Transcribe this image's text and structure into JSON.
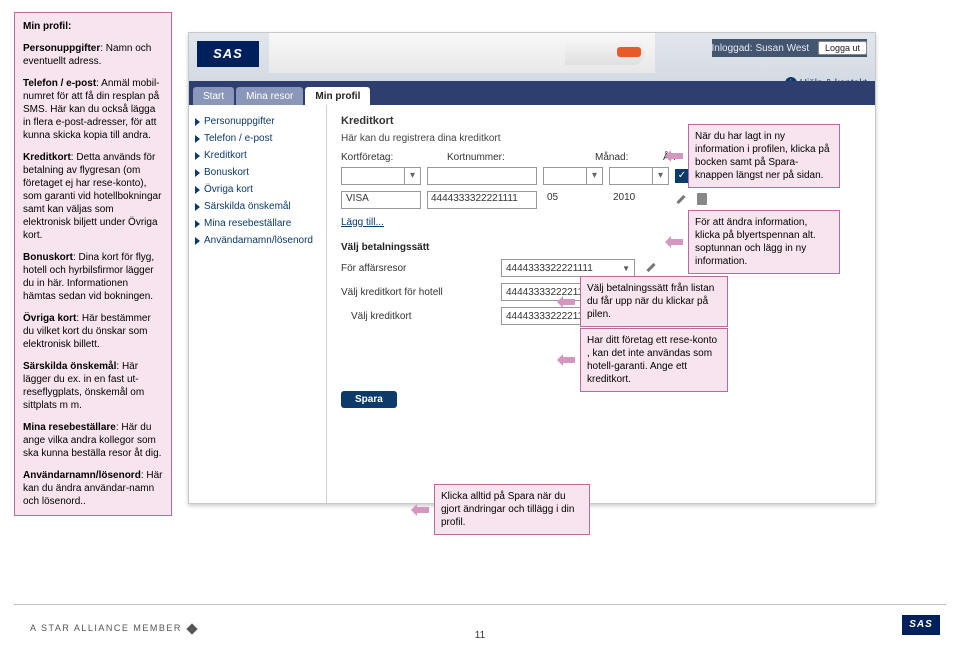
{
  "left": {
    "title": "Min profil:",
    "p1_b": "Personuppgifter",
    "p1_t": ": Namn och eventuellt adress.",
    "p2_b": "Telefon / e-post",
    "p2_t": ": Anmäl mobil-numret för att få din resplan på SMS. Här kan du också lägga in flera e-post-adresser, för att kunna skicka kopia till andra.",
    "p3_b": "Kreditkort",
    "p3_t": ": Detta används för betalning av flygresan (om företaget ej har rese-konto), som garanti vid hotellbokningar samt kan väljas som elektronisk biljett under Övriga kort.",
    "p4_b": "Bonuskort",
    "p4_t": ": Dina kort för flyg, hotell och hyrbilsfirmor lägger du in här. Informationen hämtas sedan vid bokningen.",
    "p5_b": "Övriga kort",
    "p5_t": ": Här bestämmer du vilket kort du önskar som elektronisk billett.",
    "p6_b": "Särskilda önskemål",
    "p6_t": ": Här lägger du ex. in en fast ut-reseflygplats, önskemål om sittplats m m.",
    "p7_b": "Mina resebeställare",
    "p7_t": ": Här du ange vilka andra kollegor som ska kunna beställa resor åt dig.",
    "p8_b": "Användarnamn/lösenord",
    "p8_t": ": Här kan du ändra användar-namn och lösenord.."
  },
  "header": {
    "logo": "SAS",
    "logged_prefix": "Inloggad: ",
    "user": "Susan West",
    "logout": "Logga ut",
    "help": "Hjälp & kontakt"
  },
  "tabs": {
    "t1": "Start",
    "t2": "Mina resor",
    "t3": "Min profil"
  },
  "nav": {
    "n1": "Personuppgifter",
    "n2": "Telefon / e-post",
    "n3": "Kreditkort",
    "n4": "Bonuskort",
    "n5": "Övriga kort",
    "n6": "Särskilda önskemål",
    "n7": "Mina resebeställare",
    "n8": "Användarnamn/lösenord"
  },
  "form": {
    "heading": "Kreditkort",
    "sub": "Här kan du registrera dina kreditkort",
    "lbl_company": "Kortföretag:",
    "lbl_number": "Kortnummer:",
    "lbl_month": "Månad:",
    "lbl_year": "År:",
    "row2_company": "VISA",
    "row2_number": "4444333322221111",
    "row2_month": "05",
    "row2_year": "2010",
    "add": "Lägg till...",
    "pay_heading": "Välj betalningssätt",
    "pay_sub": "För affärsresor",
    "pay_hotel_label": "Välj kreditkort för hotell",
    "pay_hotel_sub": "Välj kreditkort",
    "pay_value": "4444333322221111"
  },
  "save": "Spara",
  "callouts": {
    "c1": "När du har lagt in ny information i profilen, klicka på bocken samt på Spara-knappen längst ner på sidan.",
    "c2": "För att ändra information, klicka på blyertspennan alt. soptunnan och lägg in ny information.",
    "c3": "Välj betalningssätt från listan du får upp när du klickar på pilen.",
    "c4": "Har ditt företag ett rese-konto , kan det inte användas som hotell-garanti. Ange ett kreditkort.",
    "c5": "Klicka alltid på Spara när du gjort ändringar och tillägg i din profil."
  },
  "footer": {
    "alliance": "A STAR ALLIANCE MEMBER",
    "page": "11",
    "sas": "SAS"
  }
}
